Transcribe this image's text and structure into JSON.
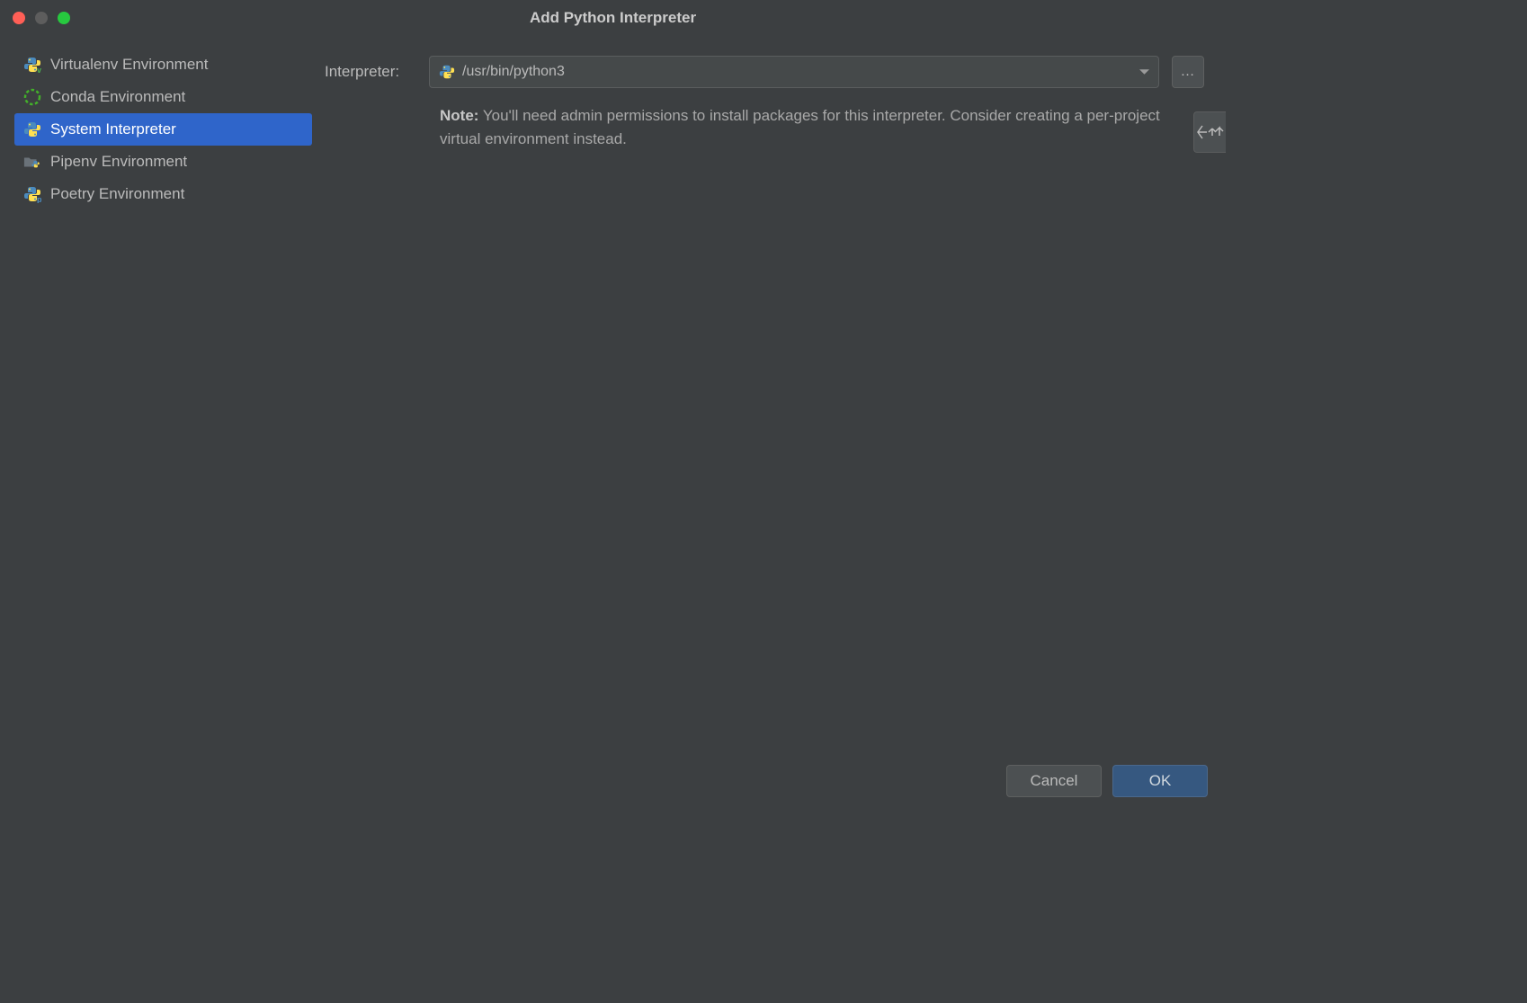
{
  "window": {
    "title": "Add Python Interpreter"
  },
  "sidebar": {
    "items": [
      {
        "label": "Virtualenv Environment",
        "icon": "python-v"
      },
      {
        "label": "Conda Environment",
        "icon": "conda"
      },
      {
        "label": "System Interpreter",
        "icon": "python"
      },
      {
        "label": "Pipenv Environment",
        "icon": "folder-python"
      },
      {
        "label": "Poetry Environment",
        "icon": "python-p"
      }
    ],
    "selectedIndex": 2
  },
  "form": {
    "interpreterLabel": "Interpreter:",
    "interpreterValue": "/usr/bin/python3",
    "browseLabel": "…"
  },
  "note": {
    "prefix": "Note:",
    "text": " You'll need admin permissions to install packages for this interpreter. Consider creating a per-project virtual environment instead."
  },
  "buttons": {
    "cancel": "Cancel",
    "ok": "OK"
  }
}
